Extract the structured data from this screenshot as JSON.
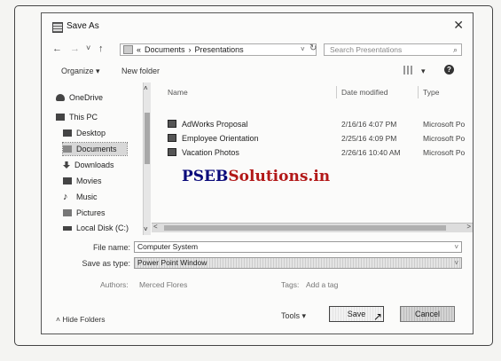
{
  "window": {
    "title": "Save As",
    "close_glyph": "✕"
  },
  "nav": {
    "back": "←",
    "forward": "→",
    "recent": "˅",
    "up": "↑",
    "path_prefix": "«",
    "path": [
      "Documents",
      "Presentations"
    ],
    "path_sep": "›",
    "dropdown": "˅",
    "refresh": "↻",
    "search_placeholder": "Search Presentations",
    "search_glyph": "⌕"
  },
  "toolbar": {
    "organize": "Organize ▾",
    "new_folder": "New folder",
    "view_arrow": "▾",
    "help": "?"
  },
  "sidebar": {
    "items": [
      {
        "label": "OneDrive",
        "icon": "cloud-icon"
      },
      {
        "label": "This PC",
        "icon": "computer-icon"
      },
      {
        "label": "Desktop",
        "icon": "desktop-icon"
      },
      {
        "label": "Documents",
        "icon": "documents-icon",
        "selected": true
      },
      {
        "label": "Downloads",
        "icon": "download-icon"
      },
      {
        "label": "Movies",
        "icon": "movies-icon"
      },
      {
        "label": "Music",
        "icon": "music-icon"
      },
      {
        "label": "Pictures",
        "icon": "pictures-icon"
      },
      {
        "label": "Local Disk (C:)",
        "icon": "disk-icon"
      }
    ],
    "scroll_up": "˄",
    "scroll_down": "˅"
  },
  "files": {
    "columns": {
      "name": "Name",
      "date": "Date modified",
      "type": "Type"
    },
    "rows": [
      {
        "name": "AdWorks Proposal",
        "date": "2/16/16 4:07 PM",
        "type": "Microsoft Po"
      },
      {
        "name": "Employee Orientation",
        "date": "2/25/16 4:09 PM",
        "type": "Microsoft Po"
      },
      {
        "name": "Vacation Photos",
        "date": "2/26/16 10:40 AM",
        "type": "Microsoft Po"
      }
    ],
    "scroll_left": "<",
    "scroll_right": ">"
  },
  "watermark": {
    "part1": "PSEB",
    "part2": "Solutions.in"
  },
  "form": {
    "file_name_label": "File name:",
    "file_name_value": "Computer System",
    "save_type_label": "Save as type:",
    "save_type_value": "Power Point Window",
    "dd_glyph": "˅",
    "authors_label": "Authors:",
    "authors_value": "Merced Flores",
    "tags_label": "Tags:",
    "tags_value": "Add a tag"
  },
  "footer": {
    "hide_folders": "˄ Hide Folders",
    "tools": "Tools ▾",
    "save": "Save",
    "cancel": "Cancel"
  },
  "colors": {
    "watermark_blue": "#0a0a7a",
    "watermark_red": "#b21818"
  }
}
